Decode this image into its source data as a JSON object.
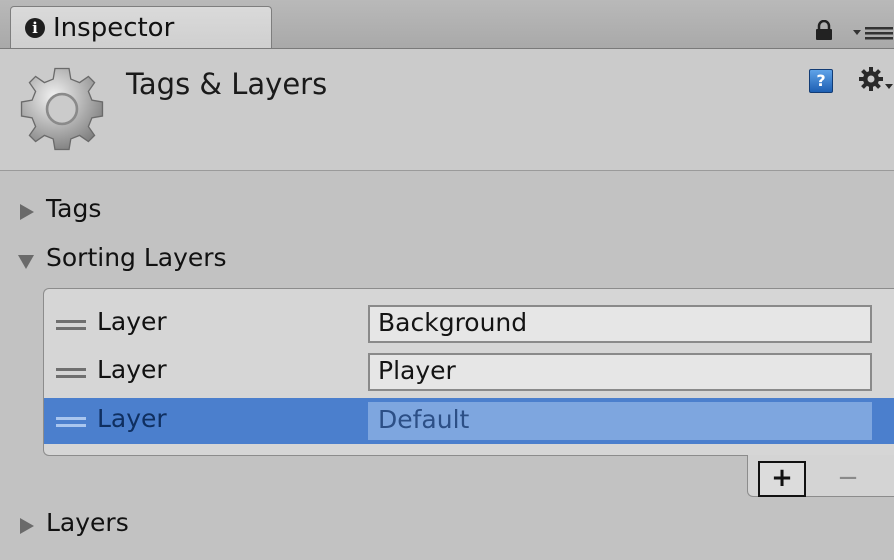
{
  "tab": {
    "label": "Inspector",
    "info_glyph": "i"
  },
  "header": {
    "title": "Tags & Layers",
    "help_glyph": "?"
  },
  "sections": {
    "tags": {
      "label": "Tags",
      "expanded": false
    },
    "sorting_layers": {
      "label": "Sorting Layers",
      "expanded": true
    },
    "layers": {
      "label": "Layers",
      "expanded": false
    }
  },
  "sorting_layers": [
    {
      "label": "Layer",
      "value": "Background",
      "selected": false
    },
    {
      "label": "Layer",
      "value": "Player",
      "selected": false
    },
    {
      "label": "Layer",
      "value": "Default",
      "selected": true
    }
  ],
  "buttons": {
    "add": "+",
    "remove": "−"
  },
  "colors": {
    "selection": "#4b7fcd",
    "panel_bg": "#c2c2c2"
  }
}
